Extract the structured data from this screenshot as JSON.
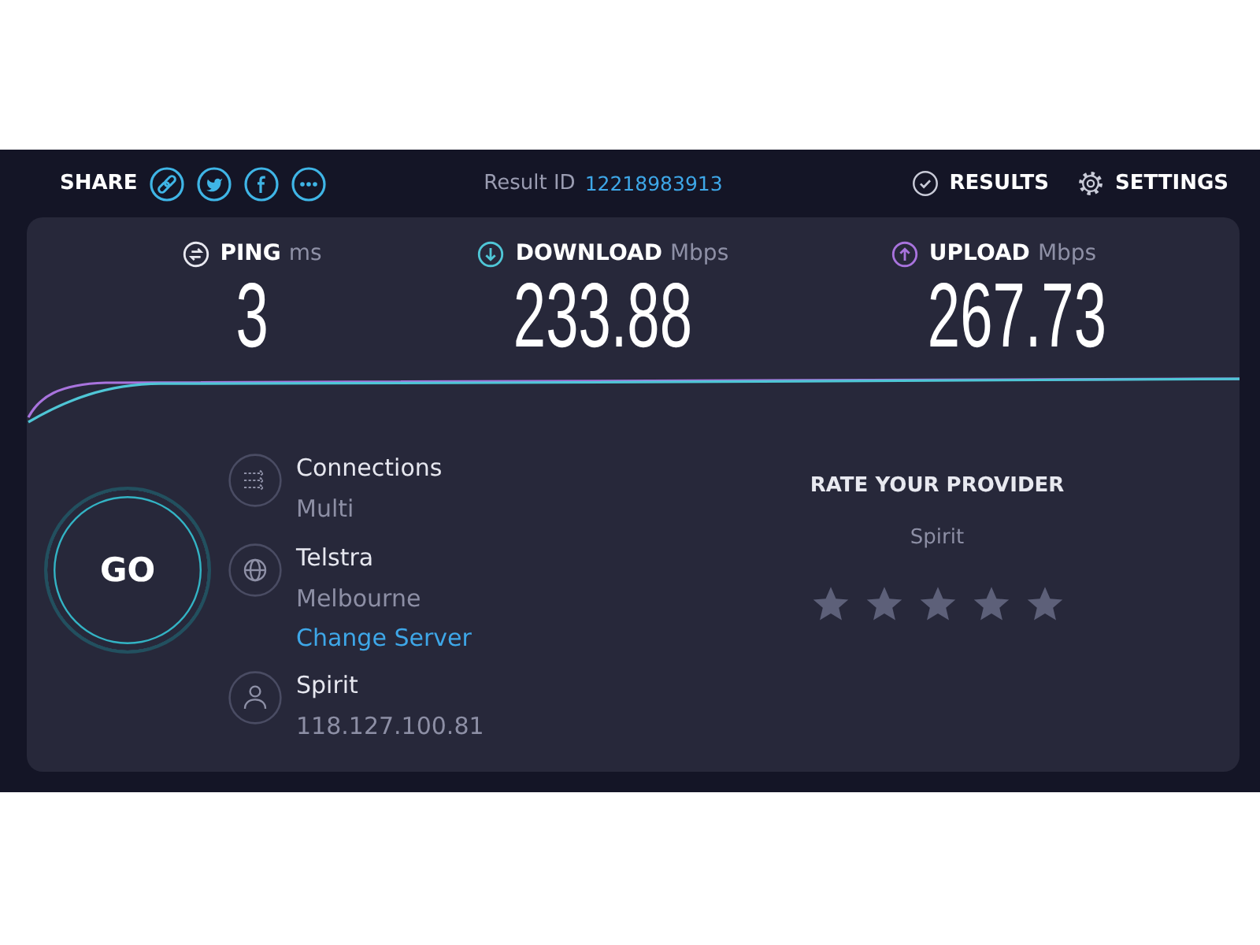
{
  "header": {
    "share_label": "SHARE",
    "result_label": "Result ID",
    "result_id": "12218983913",
    "buttons": [
      {
        "kind": "results",
        "label": "RESULTS"
      },
      {
        "kind": "settings",
        "label": "SETTINGS"
      }
    ]
  },
  "metrics": [
    {
      "label": "PING",
      "unit": "ms",
      "value": "3",
      "color": "#e8e8f0"
    },
    {
      "label": "DOWNLOAD",
      "unit": "Mbps",
      "value": "233.88",
      "color": "#4fc6d6"
    },
    {
      "label": "UPLOAD",
      "unit": "Mbps",
      "value": "267.73",
      "color": "#a873dd"
    }
  ],
  "go_button": {
    "label": "GO"
  },
  "info": [
    {
      "kind": "connections",
      "title": "Connections",
      "subtitle": "Multi"
    },
    {
      "kind": "server",
      "title": "Telstra",
      "subtitle": "Melbourne",
      "link": "Change Server"
    },
    {
      "kind": "provider",
      "title": "Spirit",
      "subtitle": "118.127.100.81"
    }
  ],
  "rate": {
    "title": "RATE YOUR PROVIDER",
    "provider": "Spirit"
  }
}
